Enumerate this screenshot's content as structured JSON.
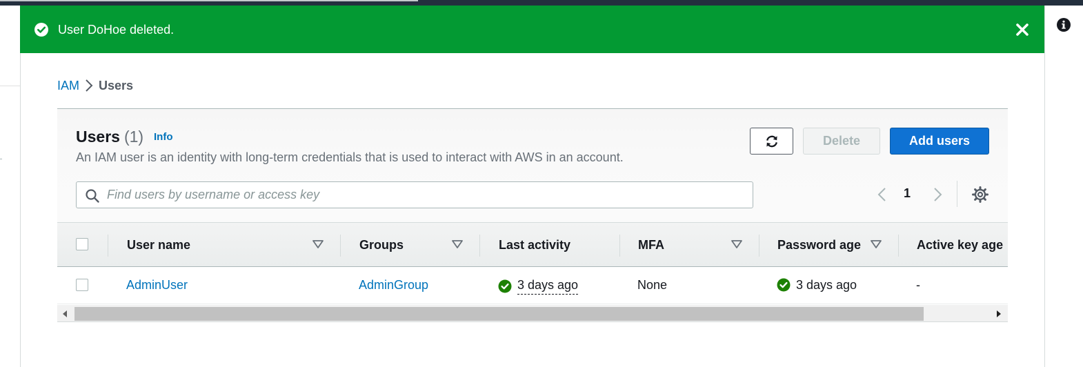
{
  "flash": {
    "message": "User DoHoe deleted.",
    "icon": "check-circle-icon",
    "background": "#039a33"
  },
  "breadcrumb": {
    "root": "IAM",
    "current": "Users"
  },
  "users_panel": {
    "title": "Users",
    "count": "(1)",
    "info_link": "Info",
    "description": "An IAM user is an identity with long-term credentials that is used to interact with AWS in an account.",
    "buttons": {
      "refresh_icon": "refresh-icon",
      "delete": "Delete",
      "add": "Add users"
    },
    "search": {
      "placeholder": "Find users by username or access key",
      "value": ""
    },
    "pagination": {
      "current_page": "1"
    }
  },
  "table": {
    "columns": [
      "User name",
      "Groups",
      "Last activity",
      "MFA",
      "Password age",
      "Active key age"
    ],
    "rows": [
      {
        "user_name": "AdminUser",
        "groups": "AdminGroup",
        "last_activity": "3 days ago",
        "mfa": "None",
        "password_age": "3 days ago",
        "active_key_age": "-"
      }
    ]
  },
  "colors": {
    "link": "#0073bb",
    "primary_button": "#0f72d3",
    "success": "#1d8102"
  }
}
